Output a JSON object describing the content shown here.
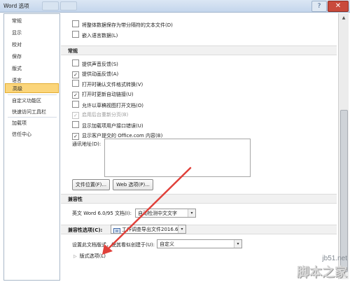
{
  "window": {
    "title": "Word 选项",
    "help_symbol": "?",
    "close_symbol": "✕"
  },
  "sidebar": {
    "items": [
      {
        "label": "常规"
      },
      {
        "label": "显示"
      },
      {
        "label": "校对"
      },
      {
        "label": "保存"
      },
      {
        "label": "版式"
      },
      {
        "label": "语言"
      },
      {
        "label": "高级",
        "selected": true
      },
      {
        "label": "自定义功能区"
      },
      {
        "label": "快速访问工具栏"
      },
      {
        "label": "加载项"
      },
      {
        "label": "信任中心"
      }
    ]
  },
  "top_options": [
    {
      "label": "将整体数据保存为带分隔符的文本文件(D)",
      "checked": false
    },
    {
      "label": "嵌入语言数据(L)",
      "checked": false
    }
  ],
  "general": {
    "header": "常规",
    "options": [
      {
        "label": "提供声音反馈(S)",
        "checked": false,
        "disabled": false
      },
      {
        "label": "提供动画反馈(A)",
        "checked": true,
        "disabled": false
      },
      {
        "label": "打开时确认文件格式转换(V)",
        "checked": false,
        "disabled": false
      },
      {
        "label": "打开时更新自动链接(U)",
        "checked": true,
        "disabled": false
      },
      {
        "label": "允许以草稿视图打开文档(O)",
        "checked": false,
        "disabled": false
      },
      {
        "label": "启用后台重新分页(B)",
        "checked": true,
        "disabled": true
      },
      {
        "label": "显示加载项用户接口错误(U)",
        "checked": false,
        "disabled": false
      },
      {
        "label": "显示客户提交的 Office.com 内容(B)",
        "checked": true,
        "disabled": false
      }
    ],
    "mailing_address_label": "通讯地址(D):",
    "mailing_address_value": "",
    "file_locations_button": "文件位置(F)...",
    "web_options_button": "Web 选项(P)..."
  },
  "compat": {
    "header": "兼容性",
    "word_label": "英文 Word 6.0/95 文档(I):",
    "word_value": "自动检测中文文字",
    "compat_options_header": "兼容性选项(C):",
    "doc_value": "工作调查导出文件2016.6.28",
    "layout_label": "设置此文档版式，使其看似创建于(U):",
    "layout_value": "自定义",
    "layout_options_label": "版式选项(L)"
  },
  "icons": {
    "checkmark": "✓",
    "dropdown": "▾",
    "scroll_up": "▲",
    "scroll_down": "▼",
    "expand": "▷"
  },
  "colors": {
    "selected_bg": "#fbd57a",
    "arrow": "#e0403a"
  },
  "watermark": {
    "url": "jb51.net",
    "cn": "脚本之家"
  }
}
